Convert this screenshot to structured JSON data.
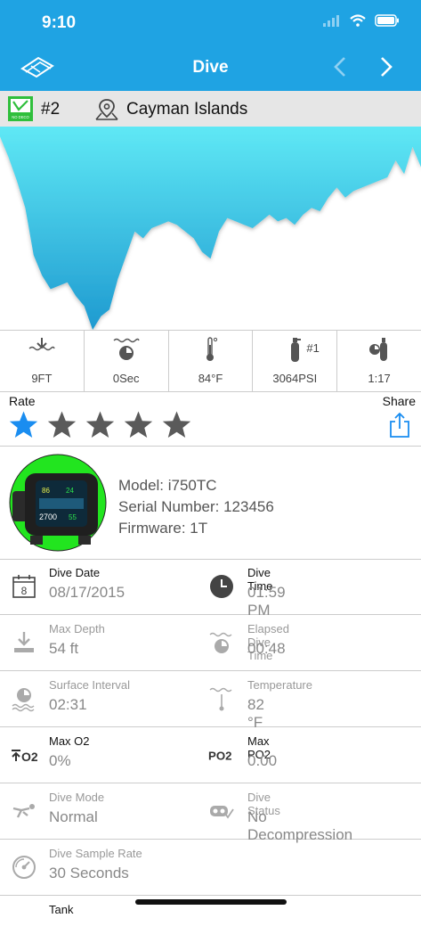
{
  "status": {
    "time": "9:10"
  },
  "nav": {
    "title": "Dive"
  },
  "location": {
    "dive_number": "#2",
    "name": "Cayman Islands",
    "badge_text": "NO DECO"
  },
  "stats": [
    {
      "icon": "max-depth-icon",
      "value": "9FT"
    },
    {
      "icon": "surface-interval-icon",
      "value": "0Sec"
    },
    {
      "icon": "thermometer-icon",
      "value": "84°F"
    },
    {
      "icon": "tank-icon",
      "tank": "#1",
      "value": "3064PSI"
    },
    {
      "icon": "elapsed-tank-icon",
      "value": "1:17"
    }
  ],
  "rating": {
    "label": "Rate",
    "share_label": "Share",
    "stars": 1,
    "max_stars": 5
  },
  "device": {
    "model": "Model: i750TC",
    "serial": "Serial Number: 123456",
    "firmware": "Firmware: 1T",
    "screen_readouts": [
      "86",
      "24",
      "2700",
      "55"
    ]
  },
  "details": {
    "dive_date": {
      "label": "Dive Date",
      "value": "08/17/2015",
      "icon_day": "8"
    },
    "dive_time": {
      "label": "Dive Time",
      "value": "01:59 PM"
    },
    "max_depth": {
      "label": "Max Depth",
      "value": "54 ft"
    },
    "elapsed": {
      "label": "Elapsed Dive Time",
      "value": "00:48"
    },
    "surface_interval": {
      "label": "Surface Interval",
      "value": "02:31"
    },
    "temperature": {
      "label": "Temperature",
      "value": "82 °F"
    },
    "max_o2": {
      "label": "Max O2",
      "value": "0%",
      "icon_text": "O2"
    },
    "max_po2": {
      "label": "Max PO2",
      "value": "0.00",
      "icon_text": "PO2"
    },
    "dive_mode": {
      "label": "Dive Mode",
      "value": "Normal"
    },
    "dive_status": {
      "label": "Dive Status",
      "value": "No Decompression"
    },
    "sample_rate": {
      "label": "Dive Sample Rate",
      "value": "30 Seconds"
    },
    "tank": {
      "label": "Tank"
    }
  },
  "colors": {
    "accent": "#1fa3e3",
    "graph_top": "#5fe8f5",
    "graph_bottom": "#1e9ad0",
    "star_active": "#1a8df0",
    "star_inactive": "#5a5a5a"
  },
  "chart_data": {
    "type": "area",
    "title": "",
    "xlabel": "",
    "ylabel": "",
    "x": [
      0,
      1,
      2,
      3,
      4,
      5,
      6,
      7,
      8,
      9,
      10,
      11,
      12,
      13,
      14,
      15,
      16,
      17,
      18,
      19,
      20,
      21,
      22,
      23,
      24,
      25,
      26,
      27,
      28,
      29,
      30,
      31,
      32,
      33,
      34,
      35,
      36,
      37,
      38,
      39,
      40,
      41,
      42,
      43,
      44,
      45,
      46,
      47,
      48,
      49,
      50
    ],
    "series": [
      {
        "values": [
          3,
          9,
          16,
          24,
          38,
          44,
          48,
          47,
          46,
          50,
          53,
          60,
          56,
          54,
          45,
          38,
          31,
          33,
          30,
          29,
          28,
          29,
          31,
          33,
          37,
          39,
          31,
          27,
          28,
          29,
          30,
          28,
          26,
          28,
          27,
          29,
          26,
          24,
          25,
          21,
          18,
          21,
          19,
          18,
          17,
          16,
          15,
          10,
          14,
          6,
          12
        ]
      }
    ]
  }
}
